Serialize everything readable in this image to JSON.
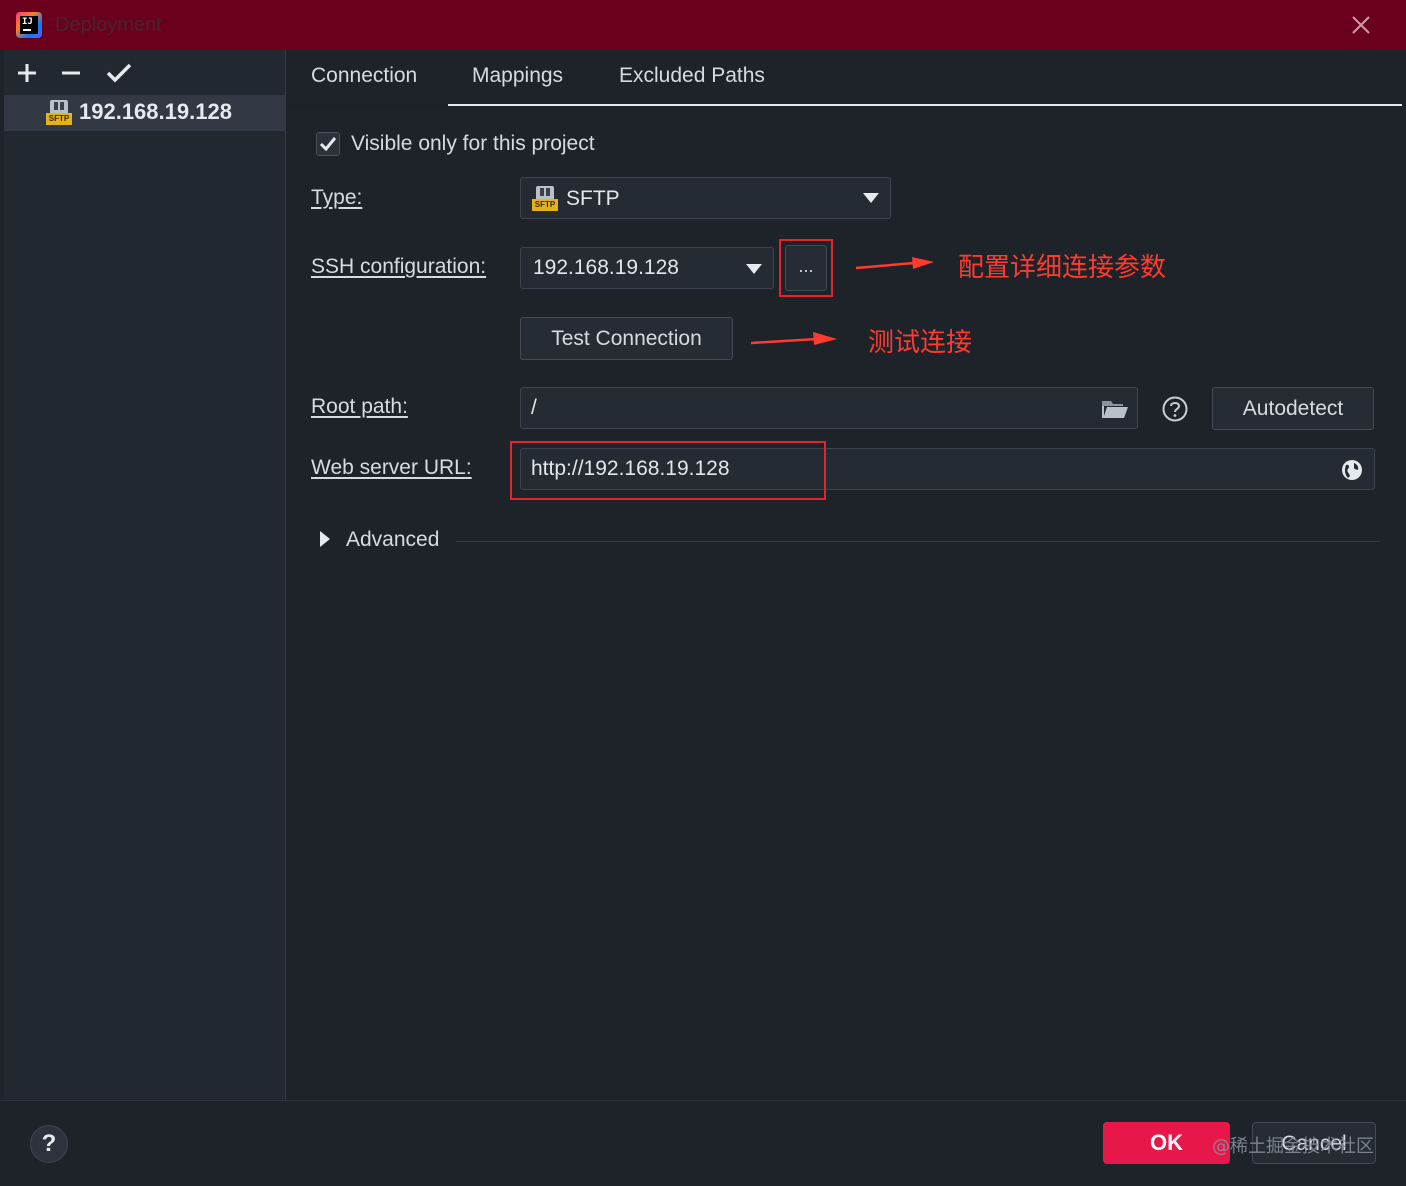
{
  "window": {
    "title": "Deployment"
  },
  "toolbar": {
    "add": "+",
    "remove": "−",
    "apply": "✔"
  },
  "servers": [
    {
      "name": "192.168.19.128",
      "type_tag": "SFTP"
    }
  ],
  "tabs": [
    {
      "label": "Connection",
      "active": true
    },
    {
      "label": "Mappings",
      "active": false
    },
    {
      "label": "Excluded Paths",
      "active": false
    }
  ],
  "connection": {
    "visible_only_label": "Visible only for this project",
    "visible_only_checked": true,
    "type_label": "Type:",
    "type_value": "SFTP",
    "ssh_label": "SSH configuration:",
    "ssh_value": "192.168.19.128",
    "ssh_more_button": "...",
    "test_connection_button": "Test Connection",
    "root_path_label": "Root path:",
    "root_path_value": "/",
    "autodetect_button": "Autodetect",
    "web_url_label": "Web server URL:",
    "web_url_value": "http://192.168.19.128",
    "advanced_label": "Advanced"
  },
  "annotations": {
    "ssh_note": "配置详细连接参数",
    "test_note": "测试连接"
  },
  "footer": {
    "help": "?",
    "ok": "OK",
    "cancel": "Cancel",
    "watermark": "@稀土掘金技术社区"
  },
  "colors": {
    "titlebar": "#6b001c",
    "accent_ok": "#e8174a",
    "annotation": "#ff3b30",
    "background": "#1e232a"
  }
}
